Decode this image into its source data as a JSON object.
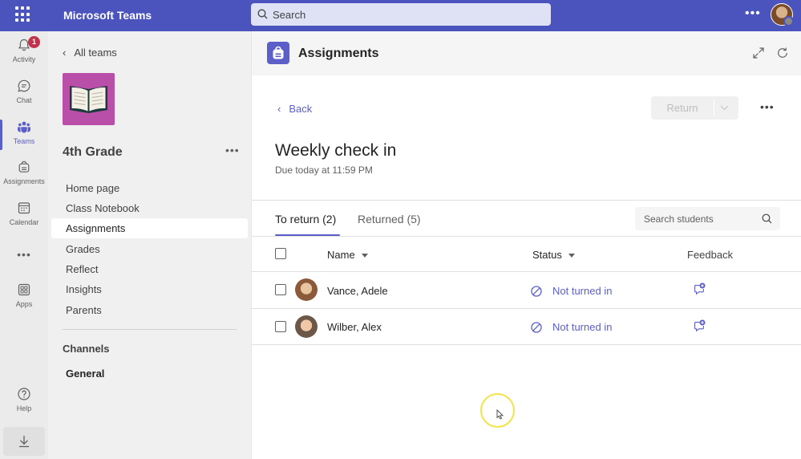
{
  "app": {
    "title": "Microsoft Teams"
  },
  "search": {
    "placeholder": "Search"
  },
  "rail": {
    "activity": {
      "label": "Activity",
      "badge": "1"
    },
    "chat": {
      "label": "Chat"
    },
    "teams": {
      "label": "Teams"
    },
    "assignments": {
      "label": "Assignments"
    },
    "calendar": {
      "label": "Calendar"
    },
    "apps": {
      "label": "Apps"
    },
    "help": {
      "label": "Help"
    }
  },
  "team": {
    "back_label": "All teams",
    "name": "4th Grade",
    "nav": [
      "Home page",
      "Class Notebook",
      "Assignments",
      "Grades",
      "Reflect",
      "Insights",
      "Parents"
    ],
    "channels_heading": "Channels",
    "channels": [
      "General"
    ]
  },
  "main": {
    "title": "Assignments",
    "back_label": "Back",
    "return_label": "Return",
    "assignment": {
      "title": "Weekly check in",
      "due": "Due today at 11:59 PM"
    },
    "tabs": [
      {
        "label": "To return (2)",
        "active": true
      },
      {
        "label": "Returned (5)",
        "active": false
      }
    ],
    "search_students_placeholder": "Search students",
    "columns": {
      "name": "Name",
      "status": "Status",
      "feedback": "Feedback"
    },
    "students": [
      {
        "name": "Vance, Adele",
        "status": "Not turned in"
      },
      {
        "name": "Wilber, Alex",
        "status": "Not turned in"
      }
    ]
  },
  "colors": {
    "brand": "#4b53bc",
    "accent": "#5b5fc7",
    "badge": "#c4314b",
    "team_logo": "#b94fa8"
  }
}
